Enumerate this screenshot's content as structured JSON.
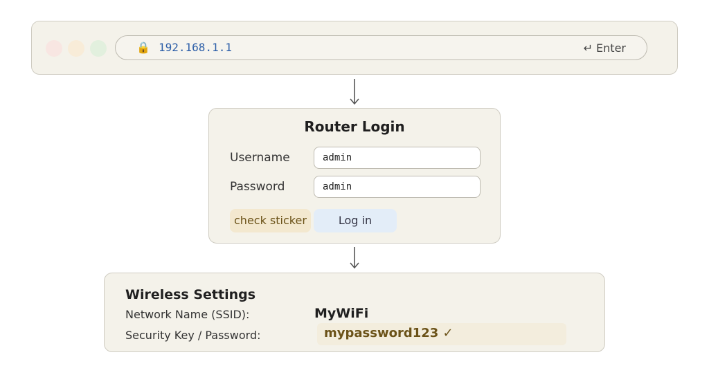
{
  "browser": {
    "url": "192.168.1.1",
    "lock_icon": "lock-icon",
    "enter_hint": "↵ Enter"
  },
  "login": {
    "title": "Router Login",
    "username_label": "Username",
    "username_value": "admin",
    "password_label": "Password",
    "password_value": "admin",
    "sticker_hint": "check sticker",
    "login_button": "Log in"
  },
  "wireless": {
    "title": "Wireless Settings",
    "ssid_label": "Network Name (SSID):",
    "ssid_value": "MyWiFi",
    "key_label": "Security Key / Password:",
    "key_value": "mypassword123 ✓"
  },
  "colors": {
    "panel_bg": "#f4f2ea",
    "url_text": "#2c5ea8",
    "sticker_bg": "#f3e8cf",
    "button_bg": "#e3edf8",
    "key_text": "#6b5218"
  }
}
